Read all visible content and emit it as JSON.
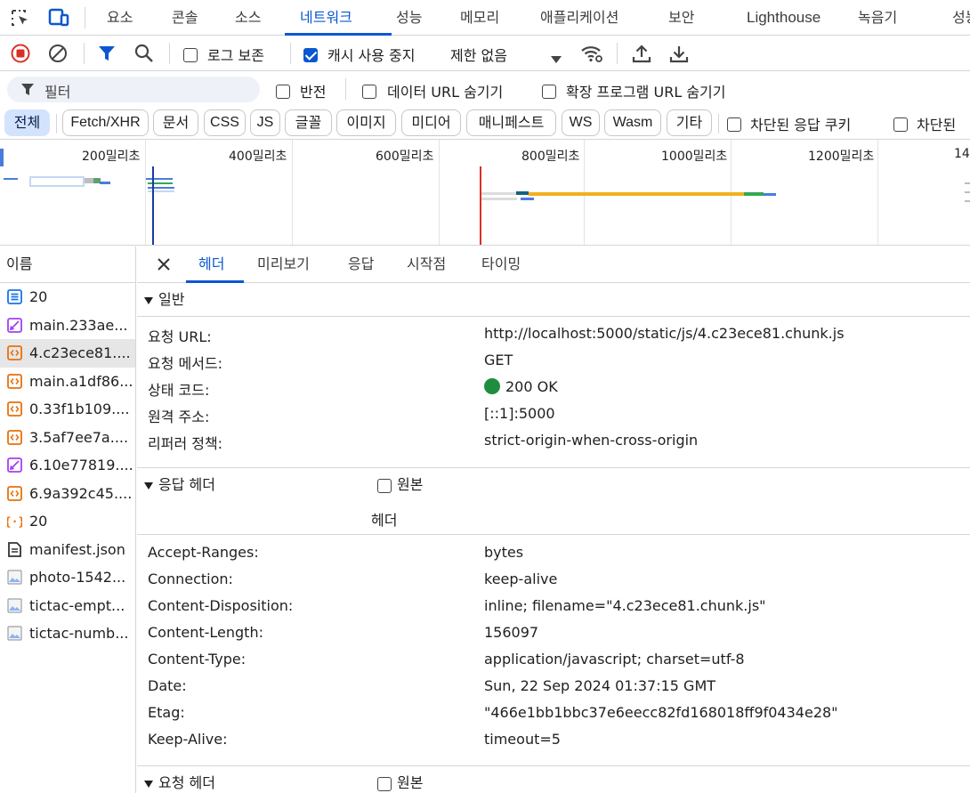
{
  "tabs": [
    "요소",
    "콘솔",
    "소스",
    "네트워크",
    "성능",
    "메모리",
    "애플리케이션",
    "보안",
    "Lighthouse",
    "녹음기",
    "성능"
  ],
  "toolbar": {
    "preserve_log": "로그 보존",
    "disable_cache": "캐시 사용 중지",
    "throttle": "제한 없음"
  },
  "filter": {
    "placeholder": "필터",
    "invert": "반전",
    "hide_data_urls": "데이터 URL 숨기기",
    "hide_ext_urls": "확장 프로그램 URL 숨기기"
  },
  "chips": [
    "전체",
    "Fetch/XHR",
    "문서",
    "CSS",
    "JS",
    "글꼴",
    "이미지",
    "미디어",
    "매니페스트",
    "WS",
    "Wasm",
    "기타"
  ],
  "chip_filters": {
    "blocked_cookies": "차단된 응답 쿠키",
    "blocked_requests": "차단된"
  },
  "overview": {
    "ticks": [
      "200밀리초",
      "400밀리초",
      "600밀리초",
      "800밀리초",
      "1000밀리초",
      "1200밀리초",
      "14"
    ]
  },
  "left": {
    "header": "이름",
    "requests": [
      {
        "name": "20",
        "type": "doc"
      },
      {
        "name": "main.233ae...",
        "type": "css"
      },
      {
        "name": "4.c23ece81....",
        "type": "js"
      },
      {
        "name": "main.a1df86...",
        "type": "js"
      },
      {
        "name": "0.33f1b109....",
        "type": "js"
      },
      {
        "name": "3.5af7ee7a....",
        "type": "js"
      },
      {
        "name": "6.10e77819....",
        "type": "css"
      },
      {
        "name": "6.9a392c45....",
        "type": "js"
      },
      {
        "name": "20",
        "type": "fetch"
      },
      {
        "name": "manifest.json",
        "type": "manifest"
      },
      {
        "name": "photo-1542...",
        "type": "img"
      },
      {
        "name": "tictac-empt...",
        "type": "img"
      },
      {
        "name": "tictac-numb...",
        "type": "img"
      }
    ]
  },
  "details": {
    "tabs": [
      "헤더",
      "미리보기",
      "응답",
      "시작점",
      "타이밍"
    ],
    "general": {
      "title": "일반",
      "rows": [
        {
          "k": "요청 URL:",
          "v": "http://localhost:5000/static/js/4.c23ece81.chunk.js"
        },
        {
          "k": "요청 메서드:",
          "v": "GET"
        },
        {
          "k": "상태 코드:",
          "v": "200 OK"
        },
        {
          "k": "원격 주소:",
          "v": "[::1]:5000"
        },
        {
          "k": "리퍼러 정책:",
          "v": "strict-origin-when-cross-origin"
        }
      ]
    },
    "response_headers": {
      "title": "응답 헤더",
      "raw": "원본",
      "subtitle": "헤더",
      "rows": [
        {
          "k": "Accept-Ranges:",
          "v": "bytes"
        },
        {
          "k": "Connection:",
          "v": "keep-alive"
        },
        {
          "k": "Content-Disposition:",
          "v": "inline; filename=\"4.c23ece81.chunk.js\""
        },
        {
          "k": "Content-Length:",
          "v": "156097"
        },
        {
          "k": "Content-Type:",
          "v": "application/javascript; charset=utf-8"
        },
        {
          "k": "Date:",
          "v": "Sun, 22 Sep 2024 01:37:15 GMT"
        },
        {
          "k": "Etag:",
          "v": "\"466e1bb1bbc37e6eecc82fd168018ff9f0434e28\""
        },
        {
          "k": "Keep-Alive:",
          "v": "timeout=5"
        }
      ]
    },
    "request_headers": {
      "title": "요청 헤더",
      "raw": "원본"
    }
  },
  "colors": {
    "accent": "#0b57d0",
    "status_ok": "#1e8e3e",
    "record": "#d93025"
  }
}
